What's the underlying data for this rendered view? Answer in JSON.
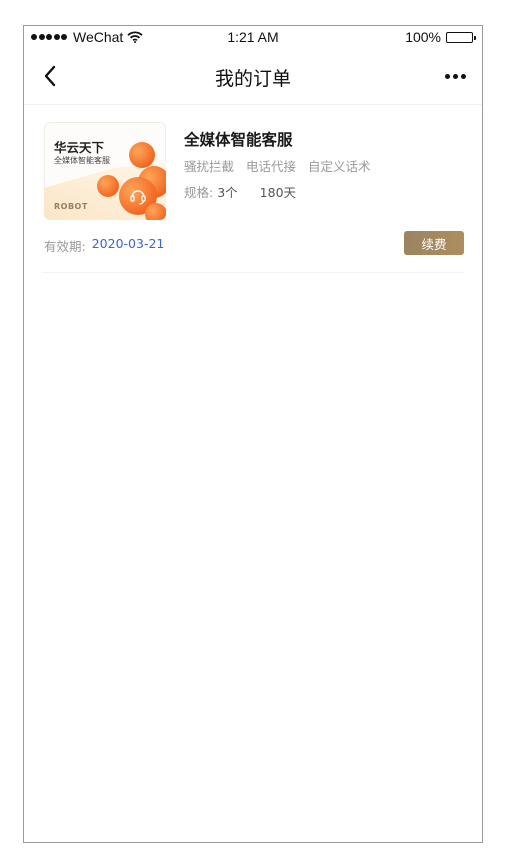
{
  "status_bar": {
    "carrier": "WeChat",
    "time": "1:21 AM",
    "battery": "100%"
  },
  "nav": {
    "title": "我的订单"
  },
  "order": {
    "thumbnail": {
      "brand": "华云天下",
      "subtitle": "全媒体智能客服",
      "robot": "ROBOT"
    },
    "product_name": "全媒体智能客服",
    "tags": [
      "骚扰拦截",
      "电话代接",
      "自定义话术"
    ],
    "spec_label": "规格:",
    "spec_count": "3个",
    "spec_days": "180天",
    "valid_label": "有效期:",
    "valid_date": "2020-03-21",
    "renew_label": "续费"
  },
  "colors": {
    "accent_gold": "#a88a5f",
    "date_blue": "#3b66d3",
    "thumb_orange": "#f37a2c"
  }
}
